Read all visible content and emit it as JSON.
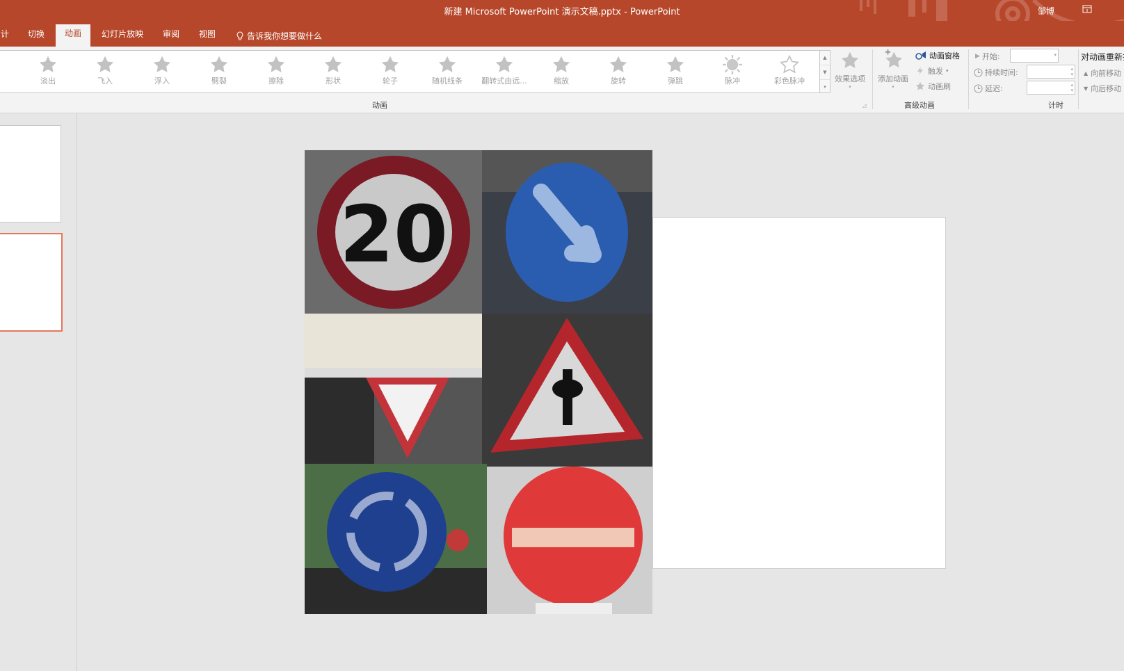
{
  "window": {
    "title": "新建 Microsoft PowerPoint 演示文稿.pptx  -  PowerPoint",
    "user": "邹博"
  },
  "tabs": [
    {
      "label": "计",
      "active": false
    },
    {
      "label": "切换",
      "active": false
    },
    {
      "label": "动画",
      "active": true
    },
    {
      "label": "幻灯片放映",
      "active": false
    },
    {
      "label": "审阅",
      "active": false
    },
    {
      "label": "视图",
      "active": false
    }
  ],
  "tell_me": "告诉我你想要做什么",
  "animation_gallery": {
    "group_label": "动画",
    "effects": [
      "淡出",
      "飞入",
      "浮入",
      "劈裂",
      "擦除",
      "形状",
      "轮子",
      "随机线条",
      "翻转式由远...",
      "缩放",
      "旋转",
      "弹跳",
      "脉冲",
      "彩色脉冲"
    ],
    "effect_options": "效果选项"
  },
  "advanced_animation": {
    "group_label": "高级动画",
    "add_animation": "添加动画",
    "animation_pane": "动画窗格",
    "trigger": "触发",
    "animation_painter": "动画刷"
  },
  "timing": {
    "group_label": "计时",
    "start_label": "开始:",
    "duration_label": "持续时间:",
    "delay_label": "延迟:",
    "start_value": "",
    "duration_value": "",
    "delay_value": ""
  },
  "reorder": {
    "title": "对动画重新排序",
    "move_earlier": "向前移动",
    "move_later": "向后移动"
  },
  "slide_images": [
    {
      "name": "speed-limit-20-sign",
      "text": "20",
      "colors": {
        "bg": "#6b6b6b",
        "ring": "#7a1a24",
        "face": "#c9c9c9"
      }
    },
    {
      "name": "keep-right-sign",
      "colors": {
        "bg": "#3b3f48",
        "face": "#2a5db0",
        "arrow": "#9db8e0"
      }
    },
    {
      "name": "yield-sign",
      "colors": {
        "bg": "#e8e4d8",
        "border": "#c3343a",
        "face": "#f2f2f2"
      }
    },
    {
      "name": "priority-crossroad-sign",
      "colors": {
        "bg": "#3a3a3a",
        "border": "#b5262c",
        "face": "#d8d8d8"
      }
    },
    {
      "name": "roundabout-sign",
      "colors": {
        "bg": "#4c6e47",
        "face": "#1f3f8f",
        "arrow": "#9aa9cf"
      }
    },
    {
      "name": "no-entry-sign",
      "colors": {
        "bg": "#cfcfcf",
        "face": "#e0393a",
        "bar": "#f1c7b5"
      }
    }
  ]
}
